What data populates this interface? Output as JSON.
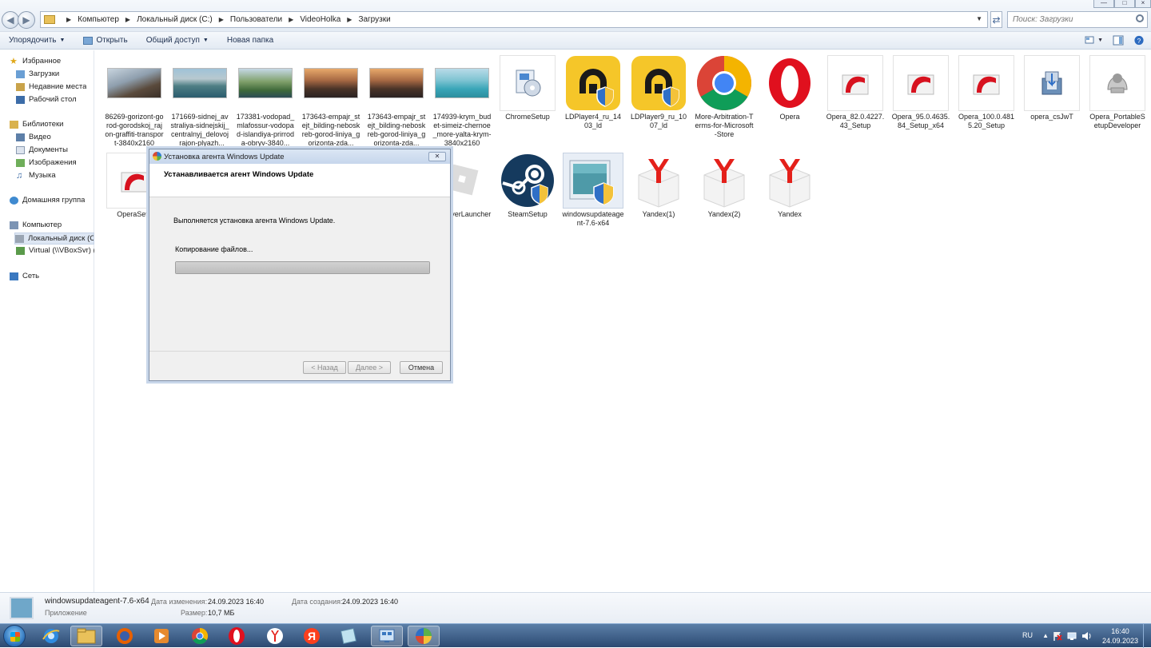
{
  "breadcrumb": [
    "Компьютер",
    "Локальный диск (C:)",
    "Пользователи",
    "VideoHolka",
    "Загрузки"
  ],
  "search": {
    "placeholder": "Поиск: Загрузки"
  },
  "toolbar": {
    "organize_label": "Упорядочить",
    "open_label": "Открыть",
    "share_label": "Общий доступ",
    "new_folder_label": "Новая папка"
  },
  "nav": {
    "favorites": "Избранное",
    "downloads": "Загрузки",
    "recent": "Недавние места",
    "desktop": "Рабочий стол",
    "libraries": "Библиотеки",
    "video": "Видео",
    "documents": "Документы",
    "images": "Изображения",
    "music": "Музыка",
    "homegroup": "Домашняя группа",
    "computer": "Компьютер",
    "local_disk": "Локальный диск (С",
    "virtual": "Virtual (\\\\VBoxSvr) (",
    "network": "Сеть"
  },
  "files_row1": [
    {
      "name": "86269-gorizont-gorod-gorodskoj_rajon-graffiti-transport-3840x2160",
      "icon": "photo-city-bridge"
    },
    {
      "name": "171669-sidnej_avstraliya-sidnejskij_centralnyj_delovoj_rajon-plyazh...",
      "icon": "photo-sydney-coast"
    },
    {
      "name": "173381-vodopad_mlafossur-vodopad-islandiya-prirroda-obryv-3840...",
      "icon": "photo-waterfall"
    },
    {
      "name": "173643-empajr_stejt_bilding-neboskreb-gorod-liniya_gorizonta-zda...",
      "icon": "photo-skyline"
    },
    {
      "name": "173643-empajr_stejt_bilding-neboskreb-gorod-liniya_gorizonta-zda...",
      "icon": "photo-skyline"
    },
    {
      "name": "174939-krym_budet-simeiz-chernoe_more-yalta-krym-3840x2160",
      "icon": "photo-sea"
    },
    {
      "name": "ChromeSetup",
      "icon": "setup-installer-icon"
    },
    {
      "name": "LDPlayer4_ru_1403_ld",
      "icon": "ldplayer-icon"
    },
    {
      "name": "LDPlayer9_ru_1007_ld",
      "icon": "ldplayer-icon"
    },
    {
      "name": "More-Arbitration-Terms-for-Microsoft-Store",
      "icon": "chrome-icon"
    },
    {
      "name": "Opera",
      "icon": "opera-icon"
    },
    {
      "name": "Opera_82.0.4227.43_Setup",
      "icon": "opera-setup-icon"
    },
    {
      "name": "Opera_95.0.4635.84_Setup_x64",
      "icon": "opera-setup-icon"
    },
    {
      "name": "Opera_100.0.4815.20_Setup",
      "icon": "opera-setup-icon"
    },
    {
      "name": "opera_csJwT",
      "icon": "installer-package-icon"
    },
    {
      "name": "Opera_PortableSetupDeveloper",
      "icon": "portable-setup-icon"
    }
  ],
  "files_row2": [
    {
      "name": "OperaSetu",
      "icon": "opera-setup-icon"
    },
    {
      "name": "oxPlayerLauncher",
      "icon": "roblox-icon"
    },
    {
      "name": "SteamSetup",
      "icon": "steam-icon"
    },
    {
      "name": "windowsupdateagent-7.6-x64",
      "icon": "windows-update-icon"
    },
    {
      "name": "Yandex(1)",
      "icon": "yandex-box-icon"
    },
    {
      "name": "Yandex(2)",
      "icon": "yandex-box-icon"
    },
    {
      "name": "Yandex",
      "icon": "yandex-box-icon"
    }
  ],
  "dialog": {
    "title": "Установка агента Windows Update",
    "heading": "Устанавливается агент Windows Update",
    "message": "Выполняется установка агента Windows Update.",
    "status": "Копирование файлов...",
    "progress_percent": 100,
    "back_label": "< Назад",
    "next_label": "Далее >",
    "cancel_label": "Отмена"
  },
  "details": {
    "name": "windowsupdateagent-7.6-x64",
    "type": "Приложение",
    "modified_label": "Дата изменения:",
    "modified_value": "24.09.2023 16:40",
    "size_label": "Размер:",
    "size_value": "10,7 МБ",
    "created_label": "Дата создания:",
    "created_value": "24.09.2023 16:40"
  },
  "taskbar": {
    "lang": "RU",
    "time": "16:40",
    "date": "24.09.2023"
  }
}
